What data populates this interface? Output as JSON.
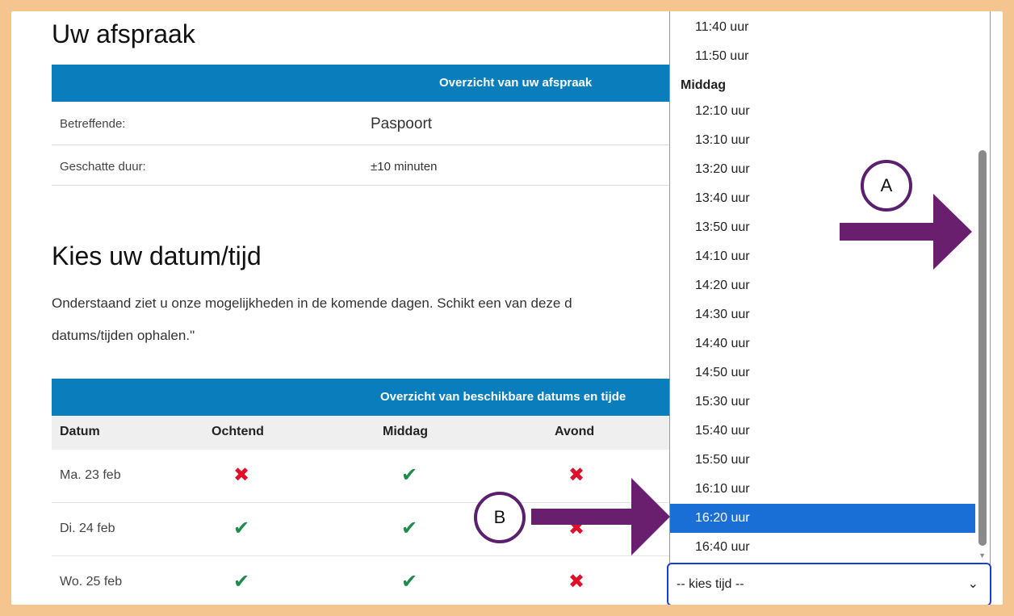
{
  "appointment": {
    "heading": "Uw afspraak",
    "overview_title": "Overzicht van uw afspraak",
    "rows": [
      {
        "label": "Betreffende:",
        "value": "Paspoort"
      },
      {
        "label": "Geschatte duur:",
        "value": "±10 minuten"
      }
    ]
  },
  "choose": {
    "heading": "Kies uw datum/tijd",
    "paragraph_line1": "Onderstaand ziet u onze mogelijkheden in de komende dagen. Schikt een van deze d",
    "paragraph_line2": "datums/tijden ophalen.\""
  },
  "availability": {
    "title": "Overzicht van beschikbare datums en tijde",
    "columns": [
      "Datum",
      "Ochtend",
      "Middag",
      "Avond"
    ],
    "rows": [
      {
        "date": "Ma. 23 feb",
        "ochtend": "no",
        "middag": "yes",
        "avond": "no"
      },
      {
        "date": "Di. 24 feb",
        "ochtend": "yes",
        "middag": "yes",
        "avond": "no"
      },
      {
        "date": "Wo. 25 feb",
        "ochtend": "yes",
        "middag": "yes",
        "avond": "no"
      }
    ]
  },
  "dropdown": {
    "options": [
      "11:40 uur",
      "11:50 uur",
      "Middag",
      "12:10 uur",
      "13:10 uur",
      "13:20 uur",
      "13:40 uur",
      "13:50 uur",
      "14:10 uur",
      "14:20 uur",
      "14:30 uur",
      "14:40 uur",
      "14:50 uur",
      "15:30 uur",
      "15:40 uur",
      "15:50 uur",
      "16:10 uur",
      "16:20 uur",
      "16:40 uur"
    ],
    "group_label": "Middag",
    "selected": "16:20 uur",
    "select_value": "-- kies tijd --"
  },
  "annotations": {
    "a": "A",
    "b": "B"
  },
  "colors": {
    "accent_blue": "#0a7ebd",
    "selected_blue": "#1a6fd6",
    "check_green": "#1e8a4c",
    "cross_red": "#e0102a",
    "frame_orange": "#f5c58f",
    "arrow_purple": "#6a1f6e"
  },
  "icons": {
    "check": "check-icon",
    "cross": "cross-icon",
    "chevron": "chevron-down-icon"
  }
}
